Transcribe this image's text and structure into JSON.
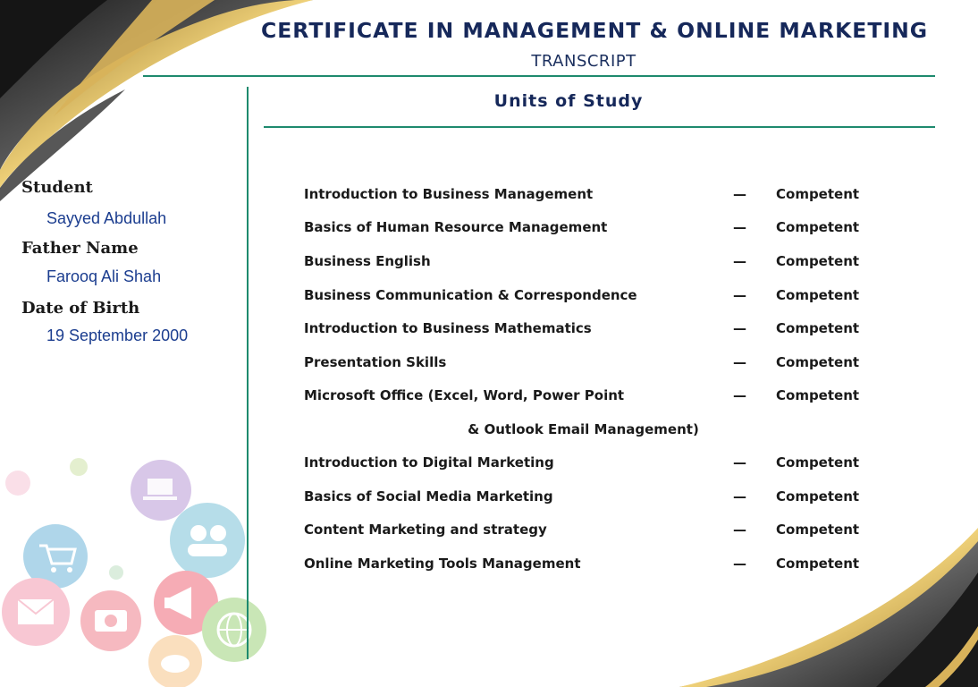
{
  "header": {
    "title": "CERTIFICATE IN MANAGEMENT & ONLINE MARKETING",
    "subtitle": "TRANSCRIPT",
    "section_title": "Units of Study"
  },
  "student": {
    "name_label": "Student",
    "name": "Sayyed Abdullah",
    "father_label": "Father Name",
    "father": "Farooq Ali Shah",
    "dob_label": "Date of Birth",
    "dob": "19 September 2000"
  },
  "units": [
    {
      "name": "Introduction to Business Management",
      "dash": "—",
      "result": "Competent"
    },
    {
      "name": "Basics of Human Resource Management",
      "dash": "—",
      "result": "Competent"
    },
    {
      "name": "Business English",
      "dash": "—",
      "result": "Competent"
    },
    {
      "name": "Business Communication & Correspondence",
      "dash": "—",
      "result": "Competent"
    },
    {
      "name": "Introduction to Business Mathematics",
      "dash": "—",
      "result": "Competent"
    },
    {
      "name": "Presentation Skills",
      "dash": "—",
      "result": "Competent"
    },
    {
      "name": "Microsoft Office (Excel, Word, Power Point",
      "dash": "—",
      "result": "Competent",
      "continuation": "& Outlook Email Management)"
    },
    {
      "name": "Introduction to Digital Marketing",
      "dash": "—",
      "result": "Competent"
    },
    {
      "name": "Basics of Social Media Marketing",
      "dash": "—",
      "result": "Competent"
    },
    {
      "name": "Content Marketing and strategy",
      "dash": "—",
      "result": "Competent"
    },
    {
      "name": "Online Marketing Tools Management",
      "dash": "—",
      "result": "Competent"
    }
  ],
  "colors": {
    "navy": "#16285a",
    "accent_green": "#1e8a6e",
    "value_blue": "#1b3d8f",
    "gold": "#c8a04a",
    "dark_swoosh": "#2b2b2b"
  },
  "icons": [
    "laptop-icon",
    "people-icon",
    "shopping-cart-icon",
    "megaphone-icon",
    "email-icon",
    "camera-icon",
    "globe-icon",
    "piggy-bank-icon"
  ]
}
